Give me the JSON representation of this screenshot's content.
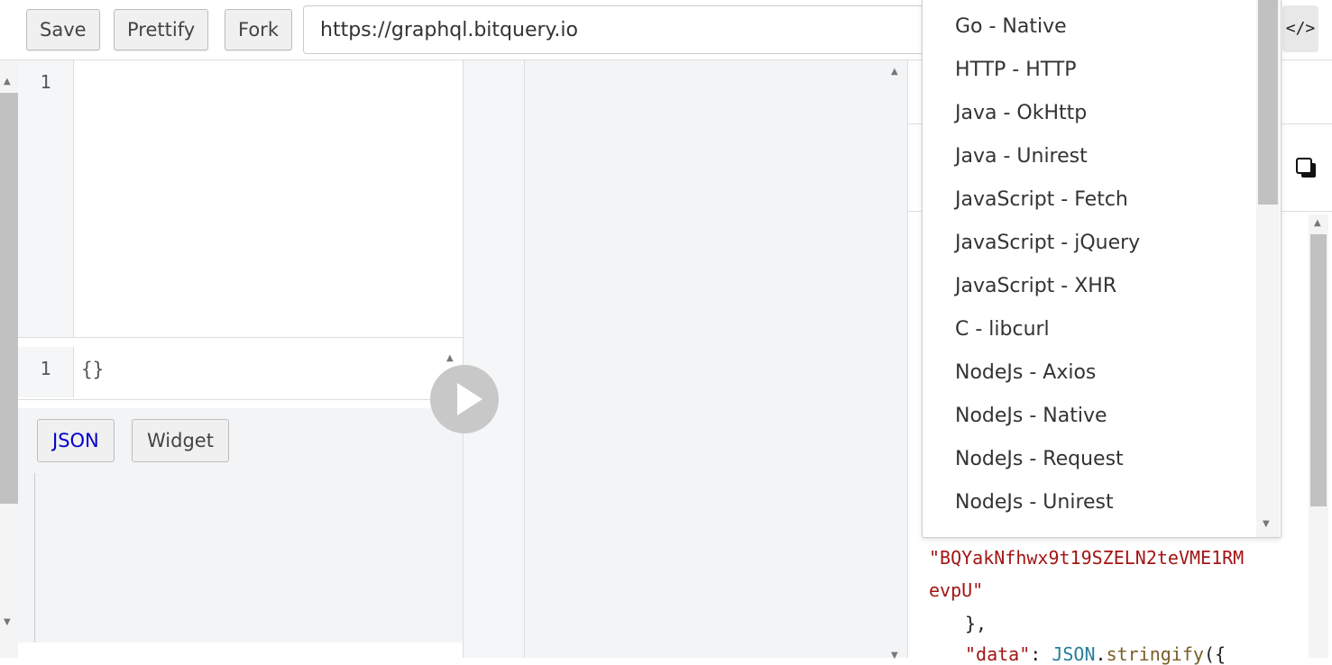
{
  "toolbar": {
    "save_label": "Save",
    "prettify_label": "Prettify",
    "fork_label": "Fork",
    "endpoint_url": "https://graphql.bitquery.io",
    "code_toggle_icon": "code-icon"
  },
  "query_editor": {
    "line_numbers": [
      "1"
    ]
  },
  "variables_editor": {
    "line_numbers": [
      "1"
    ],
    "code": "{}"
  },
  "result_tabs": {
    "json_label": "JSON",
    "widget_label": "Widget",
    "active": "JSON",
    "active_color": "#0000cc"
  },
  "language_dropdown": {
    "items": [
      "Go - Native",
      "HTTP - HTTP",
      "Java - OkHttp",
      "Java - Unirest",
      "JavaScript - Fetch",
      "JavaScript - jQuery",
      "JavaScript - XHR",
      "C - libcurl",
      "NodeJs - Axios",
      "NodeJs - Native",
      "NodeJs - Request",
      "NodeJs - Unirest"
    ]
  },
  "code_snippet": {
    "line1": "\"BQYakNfhwx9t19SZELN2teVME1RM",
    "line2": "evpU\"",
    "line3": "},",
    "line4_key": "\"data\"",
    "line4_sep": ": ",
    "line4_obj": "JSON",
    "line4_dot": ".",
    "line4_method": "stringify",
    "line4_tail": "({"
  },
  "colors": {
    "string": "#a31515",
    "play_button": "#c8c8c8"
  }
}
